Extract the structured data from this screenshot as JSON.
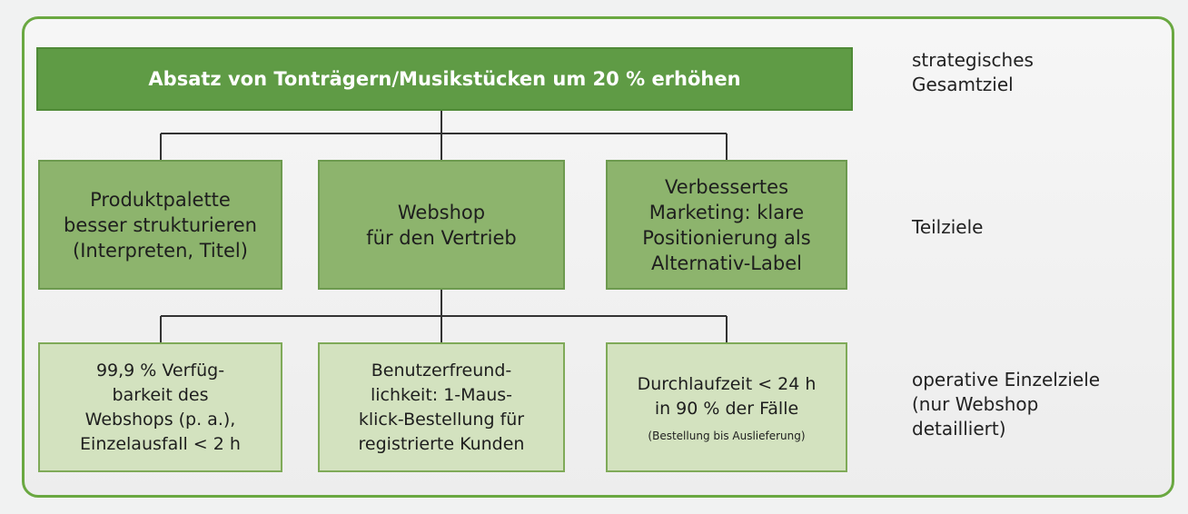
{
  "goal": {
    "text": "Absatz von Tonträgern/Musikstücken um 20 % erhöhen"
  },
  "subgoals": [
    "Produktpalette\nbesser strukturieren\n(Interpreten, Titel)",
    "Webshop\nfür den Vertrieb",
    "Verbessertes\nMarketing: klare\nPositionierung als\nAlternativ-Label"
  ],
  "operative": [
    {
      "text": "99,9 % Verfüg-\nbarkeit des\nWebshops (p. a.),\nEinzelausfall < 2 h",
      "note": ""
    },
    {
      "text": "Benutzerfreund-\nlichkeit: 1-Maus-\nklick-Bestellung für\nregistrierte Kunden",
      "note": ""
    },
    {
      "text": "Durchlaufzeit < 24 h\nin 90 % der Fälle",
      "note": "(Bestellung bis Auslieferung)"
    }
  ],
  "levels": [
    "strategisches\nGesamtziel",
    "Teilziele",
    "operative Einzelziele\n(nur Webshop\ndetailliert)"
  ],
  "colors": {
    "frame": "#6aa841",
    "top_box": "#5f9b45",
    "mid_box": "#8db46d",
    "low_box": "#d3e2bf"
  }
}
